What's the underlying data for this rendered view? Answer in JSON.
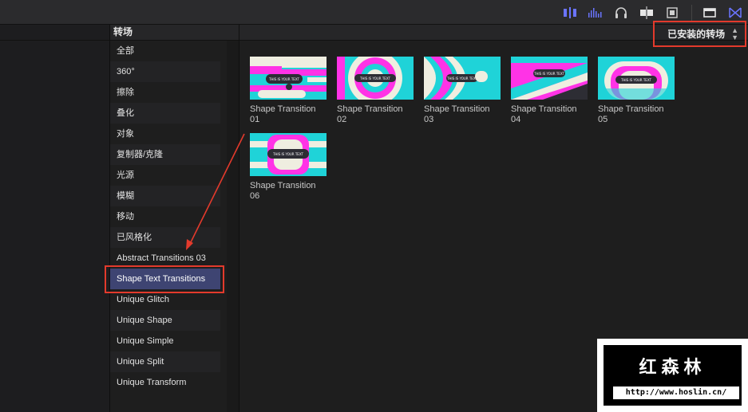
{
  "toolbar": {
    "icons": [
      "audio-meter-icon",
      "waveform-icon",
      "headphones-icon",
      "clip-skimming-icon",
      "filmstrip-icon",
      "window-icon",
      "transitions-icon"
    ]
  },
  "categories": {
    "header": "转场",
    "items": [
      "全部",
      "360°",
      "擦除",
      "叠化",
      "对象",
      "复制器/克隆",
      "光源",
      "模糊",
      "移动",
      "已风格化",
      "Abstract Transitions 03",
      "Shape Text Transitions",
      "Unique Glitch",
      "Unique Shape",
      "Unique Simple",
      "Unique Split",
      "Unique Transform"
    ],
    "selected": "Shape Text Transitions"
  },
  "browser": {
    "filter_label": "已安装的转场",
    "items": [
      {
        "name": "Shape Transition",
        "num": "01",
        "caption": "THIS IS YOUR TEXT"
      },
      {
        "name": "Shape Transition",
        "num": "02",
        "caption": "THIS IS YOUR TEXT"
      },
      {
        "name": "Shape Transition",
        "num": "03",
        "caption": "THIS IS YOUR TEXT"
      },
      {
        "name": "Shape Transition",
        "num": "04",
        "caption": "THIS IS YOUR TEXT"
      },
      {
        "name": "Shape Transition",
        "num": "05",
        "caption": "THIS IS YOUR TEXT"
      },
      {
        "name": "Shape Transition",
        "num": "06",
        "caption": "THIS IS YOUR TEXT"
      }
    ]
  },
  "watermark": {
    "title": "红森林",
    "url": "http://www.hoslin.cn/"
  },
  "colors": {
    "selection": "#3e4472",
    "highlight_box": "#e33a2c",
    "accent_icon": "#6a74ff",
    "magenta": "#ff33e6",
    "cyan": "#1fd3d8",
    "cream": "#efeee0"
  }
}
